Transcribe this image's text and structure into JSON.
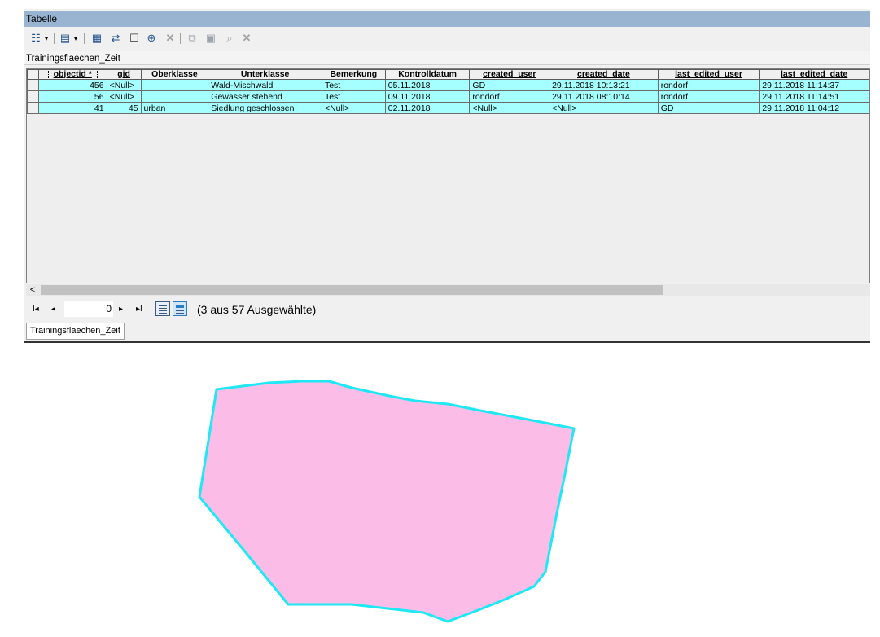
{
  "window": {
    "title": "Tabelle"
  },
  "toolbar": {
    "icons": [
      "table-options-icon",
      "related-tables-icon",
      "select-by-attributes-icon",
      "switch-selection-icon",
      "clear-selection-icon",
      "zoom-to-selected-icon",
      "delete-selected-icon",
      "copy-selected-icon",
      "paste-icon",
      "find-replace-icon",
      "delete-icon"
    ]
  },
  "table": {
    "title": "Trainingsflaechen_Zeit",
    "columns": [
      "objectid *",
      "gid",
      "Oberklasse",
      "Unterklasse",
      "Bemerkung",
      "Kontrolldatum",
      "created_user",
      "created_date",
      "last_edited_user",
      "last_edited_date"
    ],
    "rows": [
      [
        "456",
        "<Null>",
        "",
        "Wald-Mischwald",
        "Test",
        "05.11.2018",
        "GD",
        "29.11.2018 10:13:21",
        "rondorf",
        "29.11.2018 11:14:37"
      ],
      [
        "56",
        "<Null>",
        "",
        "Gewässer stehend",
        "Test",
        "09.11.2018",
        "rondorf",
        "29.11.2018 08:10:14",
        "rondorf",
        "29.11.2018 11:14:51"
      ],
      [
        "41",
        "45",
        "urban",
        "Siedlung geschlossen",
        "<Null>",
        "02.11.2018",
        "<Null>",
        "<Null>",
        "GD",
        "29.11.2018 11:04:12"
      ]
    ],
    "selection_color": "#a6ffff"
  },
  "navigation": {
    "current_record": "0",
    "selection_info": "(3 aus 57 Ausgewählte)"
  },
  "tabs": [
    {
      "label": "Trainingsflaechen_Zeit"
    }
  ],
  "map": {
    "polygon_fill": "#fbbce8",
    "polygon_outline": "#1de8f4"
  }
}
